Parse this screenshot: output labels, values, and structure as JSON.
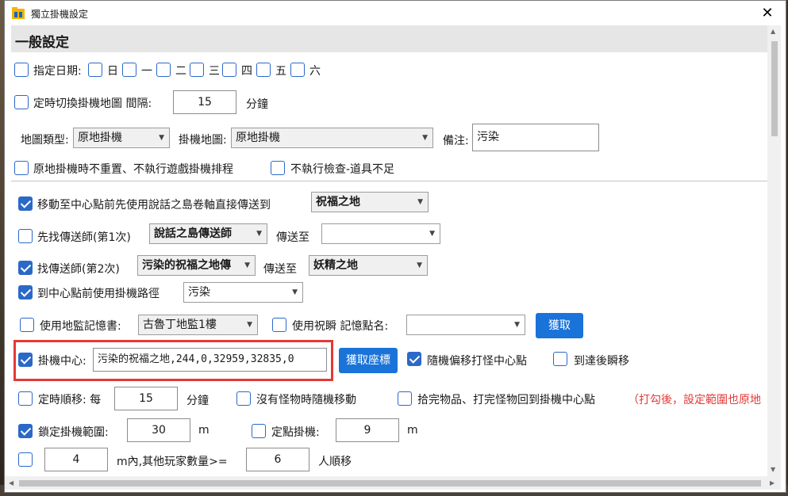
{
  "window": {
    "title": "獨立掛機設定",
    "close_glyph": "✕"
  },
  "section": {
    "title": "一般設定"
  },
  "days": {
    "label": "指定日期:",
    "items": [
      "日",
      "一",
      "二",
      "三",
      "四",
      "五",
      "六"
    ]
  },
  "map_switch": {
    "label": "定時切換掛機地圖 間隔:",
    "value": "15",
    "unit": "分鐘"
  },
  "map_type": {
    "label": "地圖類型:",
    "value": "原地掛機",
    "map_label": "掛機地圖:",
    "map_value": "原地掛機",
    "note_label": "備注:",
    "note_value": "污染"
  },
  "options": {
    "no_reset": "原地掛機時不重置、不執行遊戲掛機排程",
    "no_check": "不執行檢查-道具不足"
  },
  "move_center": {
    "label": "移動至中心點前先使用說話之島卷軸直接傳送到",
    "value": "祝福之地"
  },
  "teleporter1": {
    "label": "先找傳送師(第1次)",
    "value": "說話之島傳送師",
    "to_label": "傳送至",
    "to_value": ""
  },
  "teleporter2": {
    "label": "找傳送師(第2次)",
    "value": "污染的祝福之地傳",
    "to_label": "傳送至",
    "to_value": "妖精之地"
  },
  "path": {
    "label": "到中心點前使用掛機路徑",
    "value": "污染"
  },
  "memory": {
    "book_label": "使用地監記憶書:",
    "book_value": "古魯丁地監1樓",
    "blink_label": "使用祝瞬 記憶點名:",
    "blink_value": "",
    "fetch_button": "獲取"
  },
  "center": {
    "label": "掛機中心:",
    "value": "污染的祝福之地,244,0,32959,32835,0",
    "fetch_button": "獲取座標",
    "random_offset": "隨機偏移打怪中心點",
    "teleport_arrive": "到達後瞬移"
  },
  "timed_move": {
    "label": "定時順移: 每",
    "value": "15",
    "unit": "分鐘",
    "no_monster": "沒有怪物時隨機移動",
    "return": "拾完物品、打完怪物回到掛機中心點",
    "note": "（打勾後，設定範圍也原地"
  },
  "range": {
    "label": "鎖定掛機範圍:",
    "value": "30",
    "unit": "m",
    "fixed_label": "定點掛機:",
    "fixed_value": "9",
    "fixed_unit": "m"
  },
  "players": {
    "value1": "4",
    "mid": "m內,其他玩家數量>=",
    "value2": "6",
    "tail": "人順移"
  },
  "checked": {
    "days": false,
    "map_switch": false,
    "no_reset": false,
    "no_check": false,
    "move_center": true,
    "teleporter1": false,
    "teleporter2": true,
    "path": true,
    "book": false,
    "blink": false,
    "center": true,
    "random_offset": true,
    "teleport_arrive": false,
    "timed_move": false,
    "no_monster": false,
    "return": false,
    "range": true,
    "fixed": false,
    "players": false
  },
  "colors": {
    "accent": "#2b69c8",
    "button": "#1a73d9",
    "highlight": "#e53935"
  }
}
